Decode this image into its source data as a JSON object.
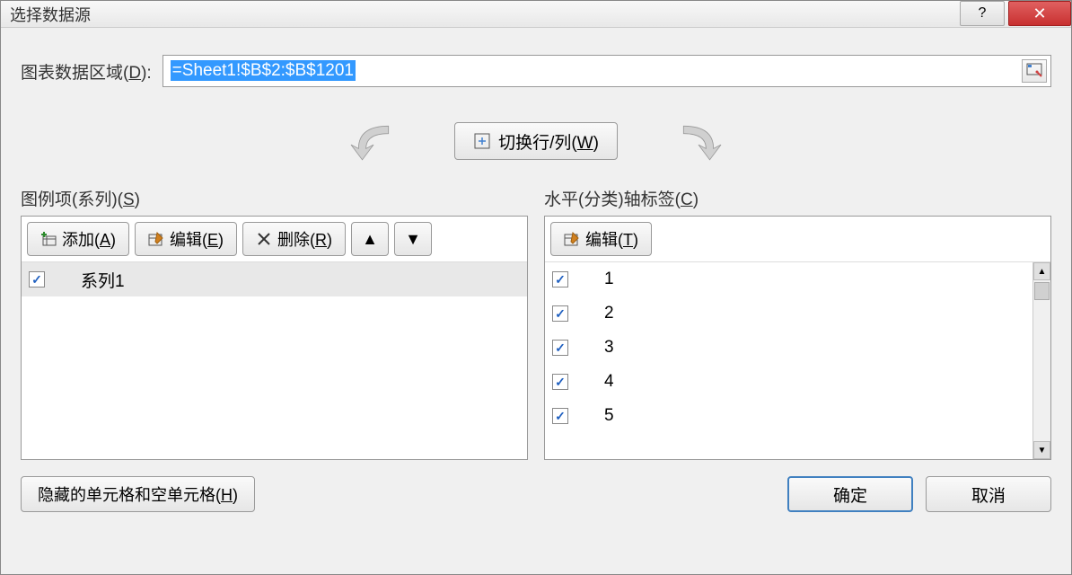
{
  "title": "选择数据源",
  "dataRange": {
    "label": "图表数据区域(D):",
    "value": "=Sheet1!$B$2:$B$1201"
  },
  "switchButton": "切换行/列(W)",
  "leftPanel": {
    "label": "图例项(系列)(S)",
    "addButton": "添加(A)",
    "editButton": "编辑(E)",
    "deleteButton": "删除(R)",
    "items": [
      {
        "label": "系列1",
        "checked": true,
        "selected": true
      }
    ]
  },
  "rightPanel": {
    "label": "水平(分类)轴标签(C)",
    "editButton": "编辑(T)",
    "items": [
      {
        "label": "1",
        "checked": true
      },
      {
        "label": "2",
        "checked": true
      },
      {
        "label": "3",
        "checked": true
      },
      {
        "label": "4",
        "checked": true
      },
      {
        "label": "5",
        "checked": true
      }
    ]
  },
  "footer": {
    "hiddenCells": "隐藏的单元格和空单元格(H)",
    "ok": "确定",
    "cancel": "取消"
  }
}
